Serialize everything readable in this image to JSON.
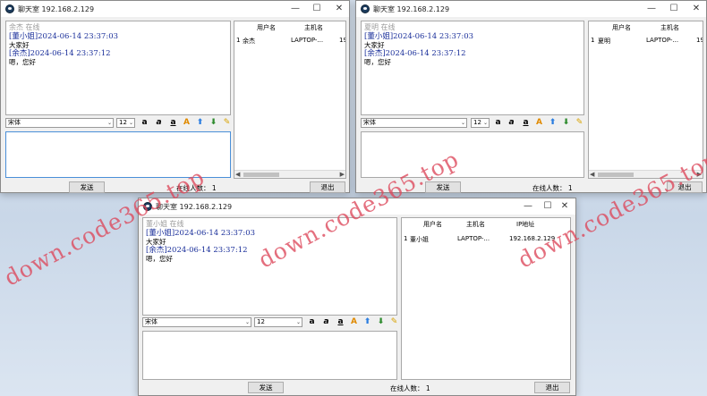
{
  "watermark": "down.code365.top",
  "windows": [
    {
      "title": "聊天室  192.168.2.129",
      "status_line": "余杰 在线",
      "messages": [
        {
          "head": "[董小姐]2024-06-14 23:37:03",
          "body": "大家好"
        },
        {
          "head": "[余杰]2024-06-14 23:37:12",
          "body": "嗯，您好"
        }
      ],
      "font_name": "宋体",
      "font_size": "12",
      "send_label": "发送",
      "online_label": "在线人数：",
      "online_count": "1",
      "exit_label": "退出",
      "columns": [
        "用户名",
        "主机名"
      ],
      "rows": [
        {
          "idx": "1",
          "user": "余杰",
          "host": "LAPTOP-...",
          "ip": "19"
        }
      ]
    },
    {
      "title": "聊天室  192.168.2.129",
      "status_line": "夏明 在线",
      "messages": [
        {
          "head": "[董小姐]2024-06-14 23:37:03",
          "body": "大家好"
        },
        {
          "head": "[余杰]2024-06-14 23:37:12",
          "body": "嗯，您好"
        }
      ],
      "font_name": "宋体",
      "font_size": "12",
      "send_label": "发送",
      "online_label": "在线人数：",
      "online_count": "1",
      "exit_label": "退出",
      "columns": [
        "用户名",
        "主机名"
      ],
      "rows": [
        {
          "idx": "1",
          "user": "夏明",
          "host": "LAPTOP-...",
          "ip": "19"
        }
      ]
    },
    {
      "title": "聊天室  192.168.2.129",
      "status_line": "董小姐 在线",
      "messages": [
        {
          "head": "[董小姐]2024-06-14 23:37:03",
          "body": "大家好"
        },
        {
          "head": "[余杰]2024-06-14 23:37:12",
          "body": "嗯，您好"
        }
      ],
      "font_name": "宋体",
      "font_size": "12",
      "send_label": "发送",
      "online_label": "在线人数：",
      "online_count": "1",
      "exit_label": "退出",
      "columns": [
        "用户名",
        "主机名",
        "IP地址"
      ],
      "rows": [
        {
          "idx": "1",
          "user": "董小姐",
          "host": "LAPTOP-...",
          "ip": "192.168.2.129"
        }
      ]
    }
  ],
  "icons": {
    "minimize": "—",
    "maximize": "☐",
    "close": "✕",
    "dropdown": "⌄",
    "bold": "a",
    "italic": "a",
    "underline": "a",
    "color": "A",
    "upload": "⬆",
    "download": "⬇",
    "clear": "✎"
  },
  "colors": {
    "message_header": "#1a2f9a",
    "watermark": "#dc465a",
    "input_focus": "#4a8fd8"
  }
}
